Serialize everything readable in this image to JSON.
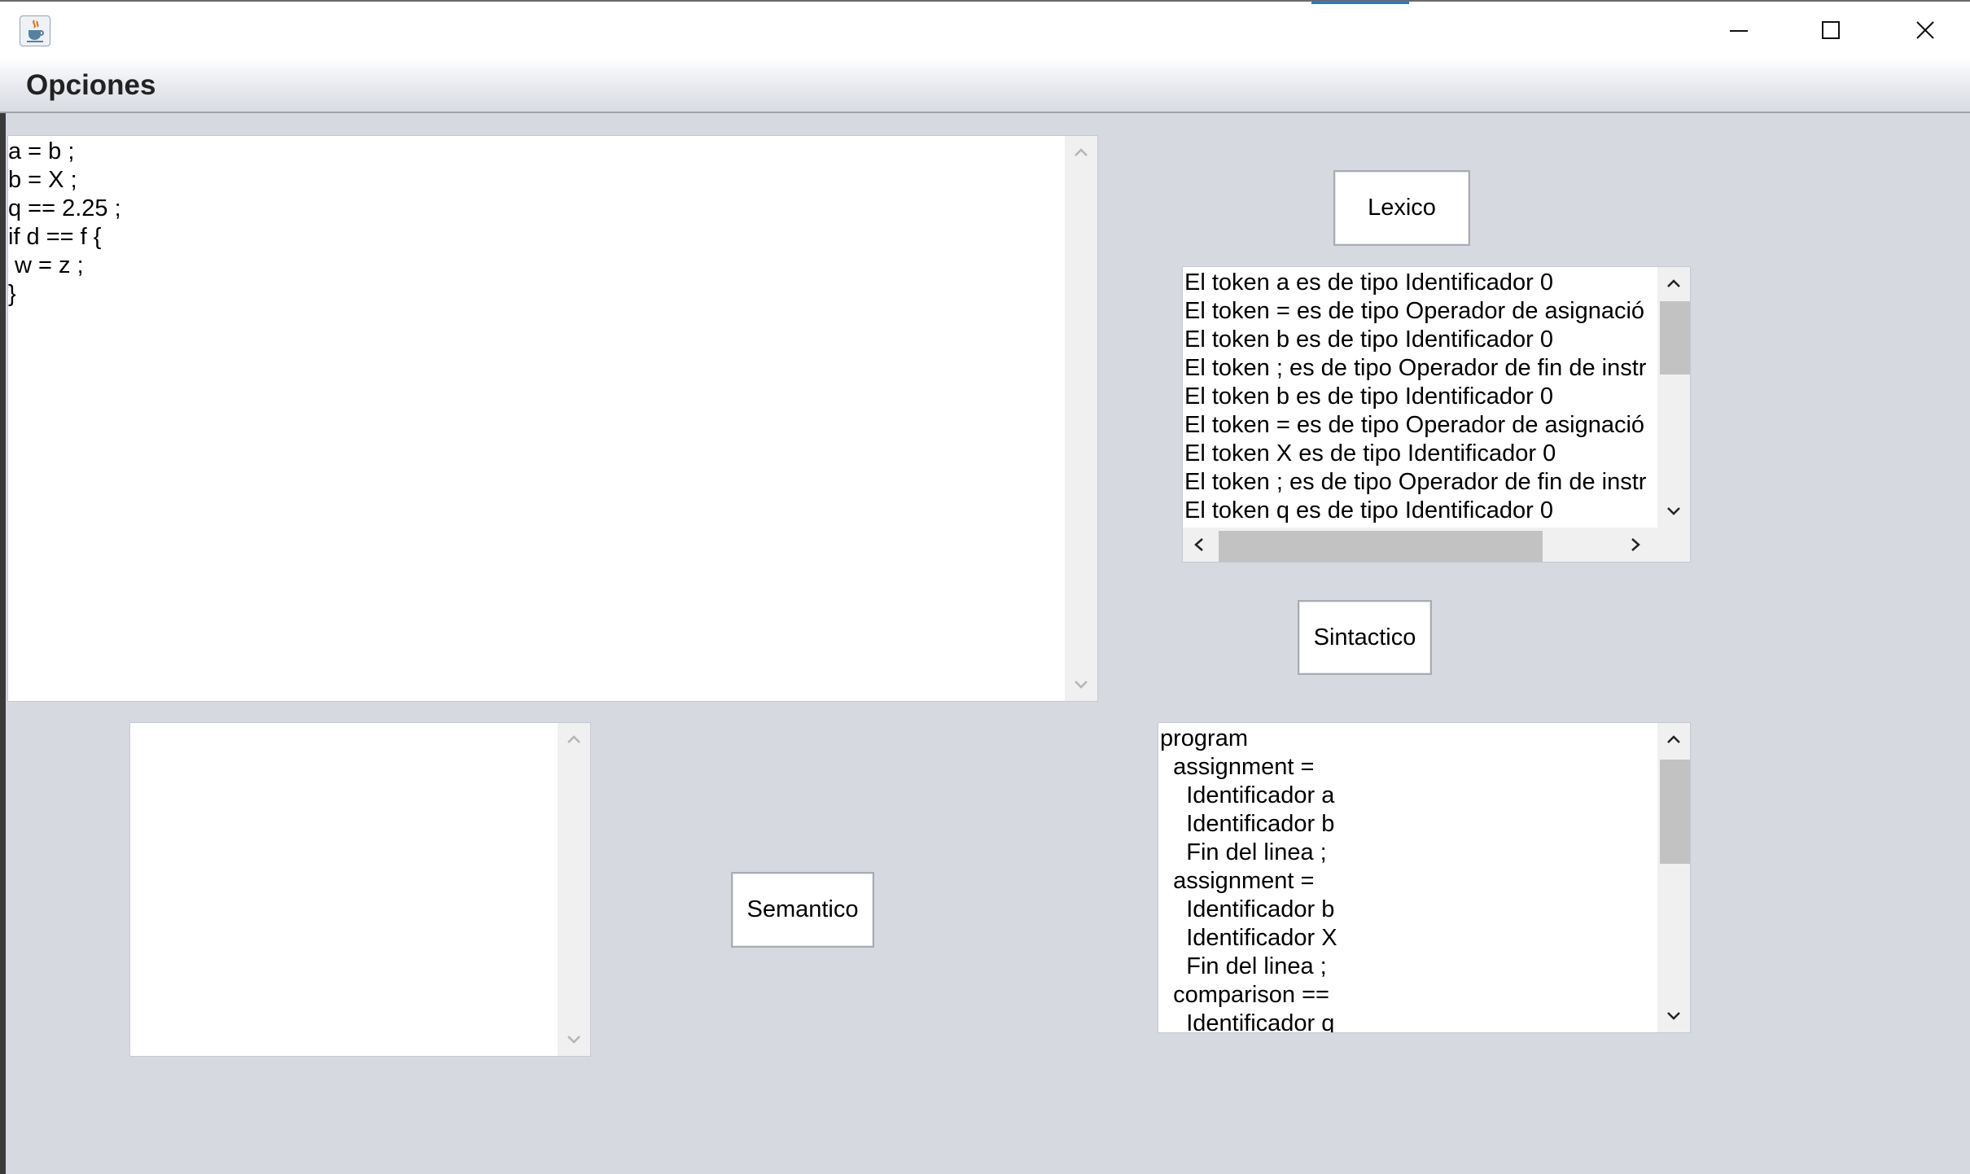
{
  "window": {
    "title": "",
    "icon": "java-cup-icon",
    "controls": [
      "minimize-icon",
      "maximize-icon",
      "close-icon"
    ]
  },
  "menubar": {
    "items": [
      {
        "label": "Opciones"
      }
    ]
  },
  "code_editor": {
    "lines": [
      "a = b ;",
      "b = X ;",
      "q == 2.25 ;",
      "if d == f {",
      " w = z ;",
      "}"
    ]
  },
  "buttons": {
    "lexico": "Lexico",
    "sintactico": "Sintactico",
    "semantico": "Semantico"
  },
  "lexico_output": {
    "lines": [
      "El token a es de tipo Identificador 0",
      "El token = es de tipo Operador de asignació",
      "El token b es de tipo Identificador 0",
      "El token ; es de tipo Operador de fin de instr",
      "El token b es de tipo Identificador 0",
      "El token = es de tipo Operador de asignació",
      "El token X es de tipo Identificador 0",
      "El token ; es de tipo Operador de fin de instr",
      "El token q es de tipo Identificador 0"
    ]
  },
  "sintactico_output": {
    "lines": [
      "program",
      "  assignment =",
      "    Identificador a",
      "    Identificador b",
      "    Fin del linea ;",
      "  assignment =",
      "    Identificador b",
      "    Identificador X",
      "    Fin del linea ;",
      "  comparison ==",
      "    Identificador q"
    ]
  },
  "semantico_output": {
    "lines": []
  },
  "colors": {
    "background": "#d6d9e0",
    "panel": "#ffffff",
    "scrollbar_track": "#f0f0f0",
    "scrollbar_thumb": "#c2c2c2",
    "accent": "#1f7bd6"
  }
}
